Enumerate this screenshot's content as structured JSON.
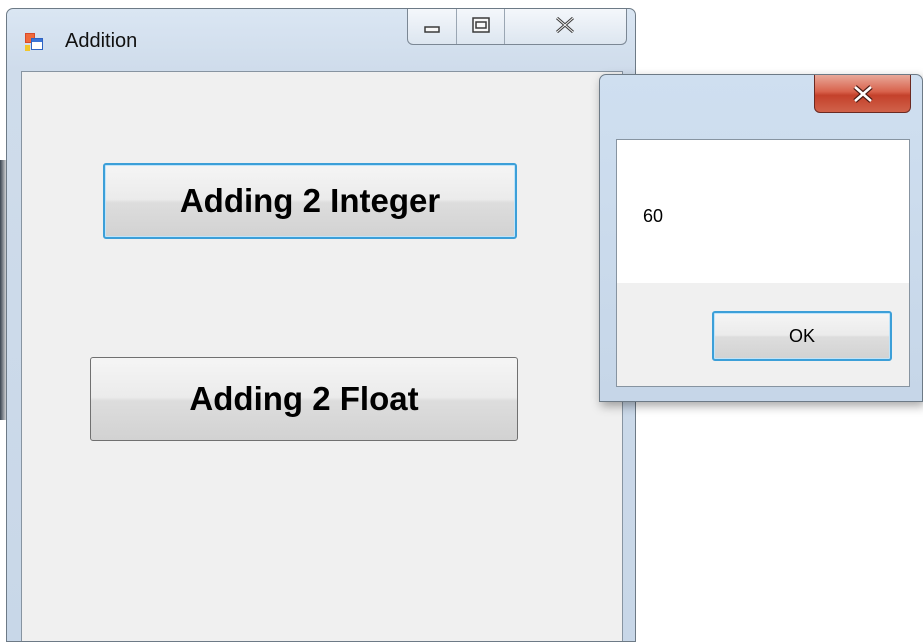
{
  "main_window": {
    "title": "Addition",
    "caption_buttons": [
      "minimize",
      "maximize",
      "close"
    ],
    "buttons": {
      "integer_label": "Adding 2 Integer",
      "float_label": "Adding 2 Float"
    }
  },
  "message_box": {
    "message": "60",
    "ok_label": "OK"
  },
  "icons": {
    "app": "winforms-app-icon",
    "minimize": "minimize-icon",
    "maximize": "maximize-icon",
    "close": "close-icon"
  },
  "colors": {
    "focus_border": "#3c9fd8",
    "close_button_red": "#c4412b",
    "client_background": "#f0f0f0"
  }
}
